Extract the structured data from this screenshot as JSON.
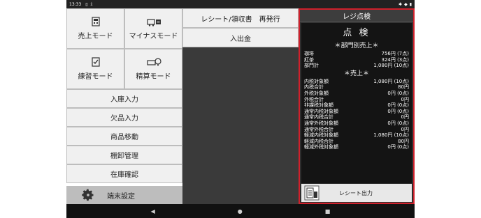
{
  "status_bar": {
    "time": "13:33"
  },
  "menu": {
    "grid": [
      {
        "label": "売上モード",
        "icon": "register-icon"
      },
      {
        "label": "マイナスモード",
        "icon": "minus-cart-icon"
      },
      {
        "label": "練習モード",
        "icon": "practice-icon"
      },
      {
        "label": "精算モード",
        "icon": "settlement-icon"
      }
    ],
    "rows": [
      "入庫入力",
      "欠品入力",
      "商品移動",
      "棚卸管理",
      "在庫確認"
    ],
    "settings": "端末設定"
  },
  "middle": {
    "buttons": [
      "レシート/領収書　再発行",
      "入出金"
    ]
  },
  "panel": {
    "header": "レジ点検",
    "title": "点 検",
    "dept_section": "＊部門別売上＊",
    "dept_lines": [
      {
        "label": "珈琲",
        "value": "756円 (7点)"
      },
      {
        "label": "紅茶",
        "value": "324円 (3点)"
      },
      {
        "label": "部門計",
        "value": "1,080円 (10点)"
      }
    ],
    "sales_section": "＊売上＊",
    "sales_lines": [
      {
        "label": "内税対象額",
        "value": "1,080円 (10点)"
      },
      {
        "label": "内税合計",
        "value": "80円"
      },
      {
        "label": "外税対象額",
        "value": "0円 (0点)"
      },
      {
        "label": "外税合計",
        "value": "0円"
      },
      {
        "label": "非課税対象額",
        "value": "0円 (0点)"
      },
      {
        "label": "通常内税対象額",
        "value": "0円 (0点)"
      },
      {
        "label": "通常内税合計",
        "value": "0円"
      },
      {
        "label": "通常外税対象額",
        "value": "0円 (0点)"
      },
      {
        "label": "通常外税合計",
        "value": "0円"
      },
      {
        "label": "軽減内税対象額",
        "value": "1,080円 (10点)"
      },
      {
        "label": "軽減内税合計",
        "value": "80円"
      },
      {
        "label": "軽減外税対象額",
        "value": "0円 (0点)"
      }
    ],
    "print_button": "レシート出力"
  },
  "colors": {
    "highlight_border": "#d0202b",
    "panel_bg": "#2e2e2e",
    "receipt_bg": "#141414"
  }
}
